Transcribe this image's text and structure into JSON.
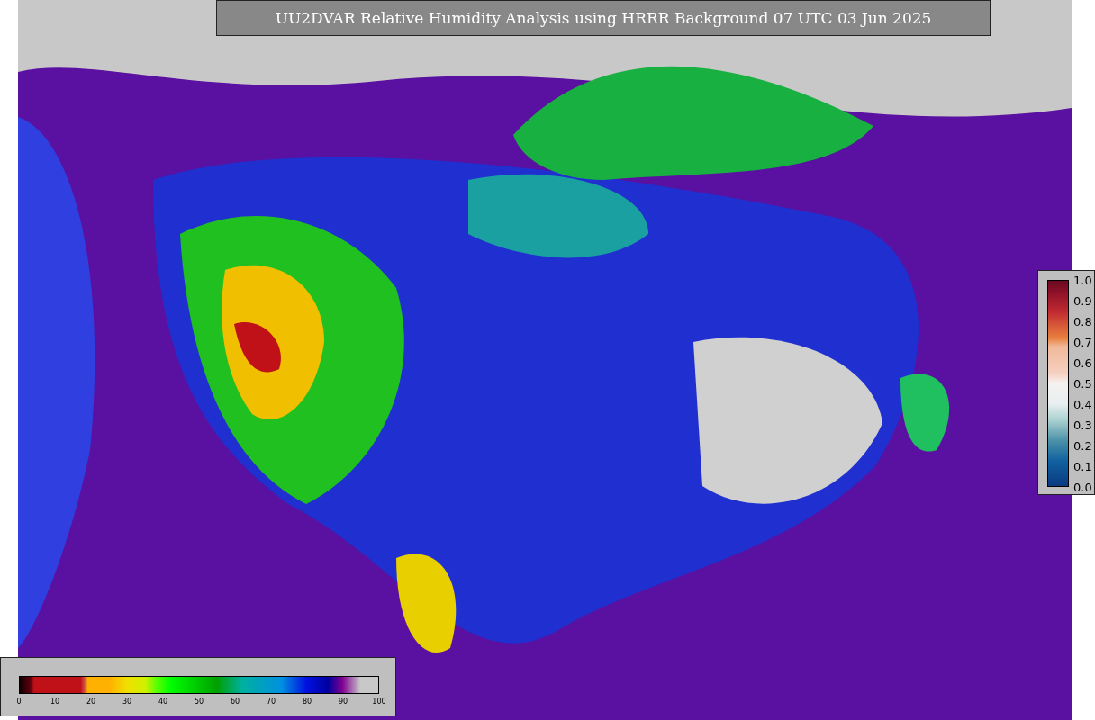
{
  "title": "UU2DVAR Relative Humidity Analysis using HRRR Background 07 UTC 03 Jun 2025",
  "humidity_legend": {
    "ticks": [
      "0",
      "10",
      "20",
      "30",
      "40",
      "50",
      "60",
      "70",
      "80",
      "90",
      "100"
    ]
  },
  "weight_legend": {
    "ticks": [
      "1.0",
      "0.9",
      "0.8",
      "0.7",
      "0.6",
      "0.5",
      "0.4",
      "0.3",
      "0.2",
      "0.1",
      "0.0"
    ]
  }
}
